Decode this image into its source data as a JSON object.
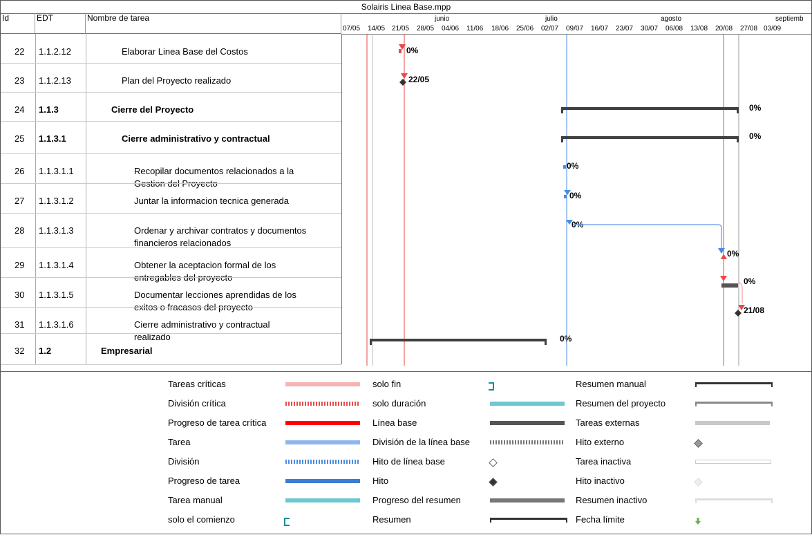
{
  "window": {
    "title": "Solairis Linea Base.mpp"
  },
  "columns": {
    "id": "Id",
    "edt": "EDT",
    "name": "Nombre de tarea"
  },
  "timeline": {
    "months": [
      "junio",
      "julio",
      "agosto",
      "septiemb"
    ],
    "weeks": [
      "07/05",
      "14/05",
      "21/05",
      "28/05",
      "04/06",
      "11/06",
      "18/06",
      "25/06",
      "02/07",
      "09/07",
      "16/07",
      "23/07",
      "30/07",
      "06/08",
      "13/08",
      "20/08",
      "27/08",
      "03/09"
    ]
  },
  "rows": [
    {
      "id": "22",
      "edt": "1.1.2.12",
      "name": "Elaborar Linea Base del Costos",
      "bold": false,
      "label": "0%"
    },
    {
      "id": "23",
      "edt": "1.1.2.13",
      "name": "Plan del Proyecto realizado",
      "bold": false,
      "label": "22/05"
    },
    {
      "id": "24",
      "edt": "1.1.3",
      "name": "Cierre del Proyecto",
      "bold": true,
      "label": "0%"
    },
    {
      "id": "25",
      "edt": "1.1.3.1",
      "name": "Cierre administrativo y contractual",
      "bold": true,
      "label": "0%"
    },
    {
      "id": "26",
      "edt": "1.1.3.1.1",
      "name": "Recopilar documentos relacionados a la",
      "name2": "Gestion del Proyecto",
      "bold": false,
      "label": "0%"
    },
    {
      "id": "27",
      "edt": "1.1.3.1.2",
      "name": "Juntar la informacion tecnica generada",
      "bold": false,
      "label": "0%"
    },
    {
      "id": "28",
      "edt": "1.1.3.1.3",
      "name": "Ordenar y archivar contratos y documentos",
      "name2": "financieros relacionados",
      "bold": false,
      "label": "0%"
    },
    {
      "id": "29",
      "edt": "1.1.3.1.4",
      "name": "Obtener la aceptacion formal de los",
      "name2": "entregables del proyecto",
      "bold": false,
      "label": "0%"
    },
    {
      "id": "30",
      "edt": "1.1.3.1.5",
      "name": "Documentar lecciones aprendidas de los",
      "name2": "exitos o fracasos del proyecto",
      "bold": false,
      "label": "0%"
    },
    {
      "id": "31",
      "edt": "1.1.3.1.6",
      "name": "Cierre administrativo y contractual",
      "name2": "realizado",
      "bold": false,
      "label": "21/08"
    },
    {
      "id": "32",
      "edt": "1.2",
      "name": "Empresarial",
      "bold": true,
      "label": "0%"
    }
  ],
  "legend": {
    "col1": [
      "Tareas críticas",
      "División crítica",
      "Progreso de tarea crítica",
      "Tarea",
      "División",
      "Progreso de tarea",
      "Tarea manual",
      "solo el comienzo"
    ],
    "col2": [
      "solo fin",
      "solo duración",
      "Línea base",
      "División de la línea base",
      "Hito de línea base",
      "Hito",
      "Progreso del resumen",
      "Resumen"
    ],
    "col3": [
      "Resumen manual",
      "Resumen del proyecto",
      "Tareas externas",
      "Hito externo",
      "Tarea inactiva",
      "Hito inactivo",
      "Resumen inactivo",
      "Fecha límite"
    ]
  },
  "colors": {
    "critical": "#e84a4a",
    "task": "#4a8be0",
    "summary": "#404040",
    "critical_light": "#f6b3b3"
  }
}
